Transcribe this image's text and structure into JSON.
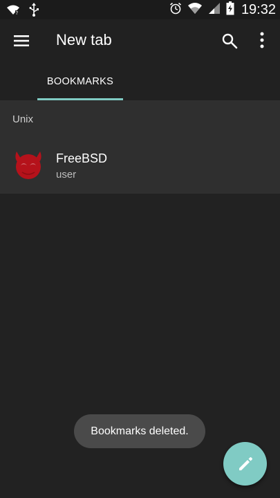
{
  "status_bar": {
    "time": "19:32",
    "icons": [
      "wifi-icon",
      "usb-icon",
      "alarm-icon",
      "wifi-signal-icon",
      "cell-signal-icon",
      "battery-charging-icon"
    ]
  },
  "app_bar": {
    "title": "New tab",
    "menu_icon": "hamburger-menu-icon",
    "search_icon": "search-icon",
    "more_icon": "more-vertical-icon"
  },
  "tabs": [
    {
      "label": "BOOKMARKS",
      "selected": true
    }
  ],
  "bookmarks": {
    "section_title": "Unix",
    "items": [
      {
        "title": "FreeBSD",
        "subtitle": "user",
        "icon": "freebsd-daemon-icon"
      }
    ]
  },
  "toast": {
    "message": "Bookmarks deleted."
  },
  "fab": {
    "icon": "edit-pencil-icon"
  },
  "colors": {
    "accent": "#80cbc4",
    "background": "#222222",
    "surface": "#2f2f2f",
    "status_bar": "#1b1b1b",
    "app_bar": "#212121",
    "toast": "#4a4a4a",
    "freebsd_red": "#b5121b"
  }
}
